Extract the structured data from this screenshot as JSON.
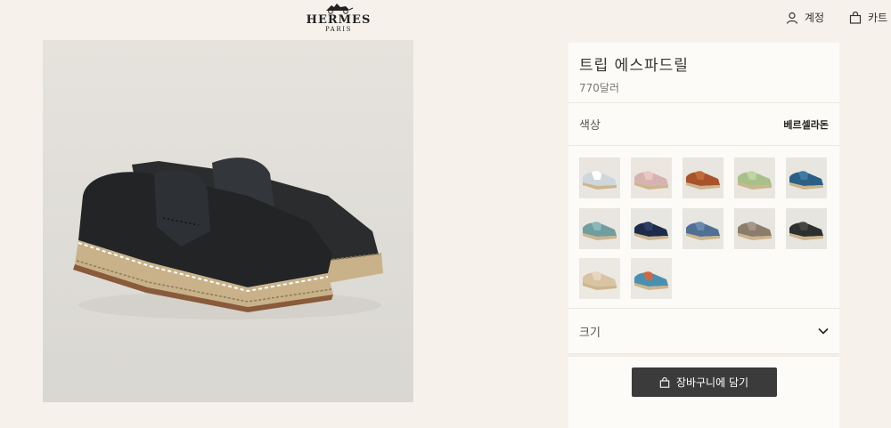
{
  "header": {
    "brand": "HERMES",
    "brand_sub": "PARIS",
    "account_label": "계정",
    "cart_label": "카트"
  },
  "product": {
    "title": "트립 에스파드릴",
    "price": "770달러",
    "color_label": "색상",
    "selected_color": "베르셀라돈",
    "size_label": "크기",
    "add_to_cart_label": "장바구니에 담기"
  },
  "swatches": [
    {
      "upper": "#cfd7dc",
      "accent": "#ffffff",
      "bg": "#e9e6e1"
    },
    {
      "upper": "#d7b3b0",
      "accent": "#e6c8c4",
      "bg": "#ece6e1"
    },
    {
      "upper": "#a8532b",
      "accent": "#c26a3c",
      "bg": "#e9e5e0"
    },
    {
      "upper": "#a9c08a",
      "accent": "#c2d4a3",
      "bg": "#e9e6e0"
    },
    {
      "upper": "#2c5f86",
      "accent": "#3f7aa3",
      "bg": "#e8e6e1"
    },
    {
      "upper": "#6f9da0",
      "accent": "#8bb7b8",
      "bg": "#e9e6e1"
    },
    {
      "upper": "#1f2b4a",
      "accent": "#2d3d63",
      "bg": "#e8e6e1"
    },
    {
      "upper": "#4f6f95",
      "accent": "#6a89ad",
      "bg": "#e8e6e1"
    },
    {
      "upper": "#8c7c6c",
      "accent": "#a5968a",
      "bg": "#e8e5e0"
    },
    {
      "upper": "#2e302e",
      "accent": "#444744",
      "bg": "#e7e5e0"
    },
    {
      "upper": "#d8c3a5",
      "accent": "#e6d6bd",
      "bg": "#ece8e2"
    },
    {
      "upper": "#4b8fb0",
      "accent": "#c86a4c",
      "bg": "#ebe7e2"
    }
  ],
  "selected_swatch": 9
}
